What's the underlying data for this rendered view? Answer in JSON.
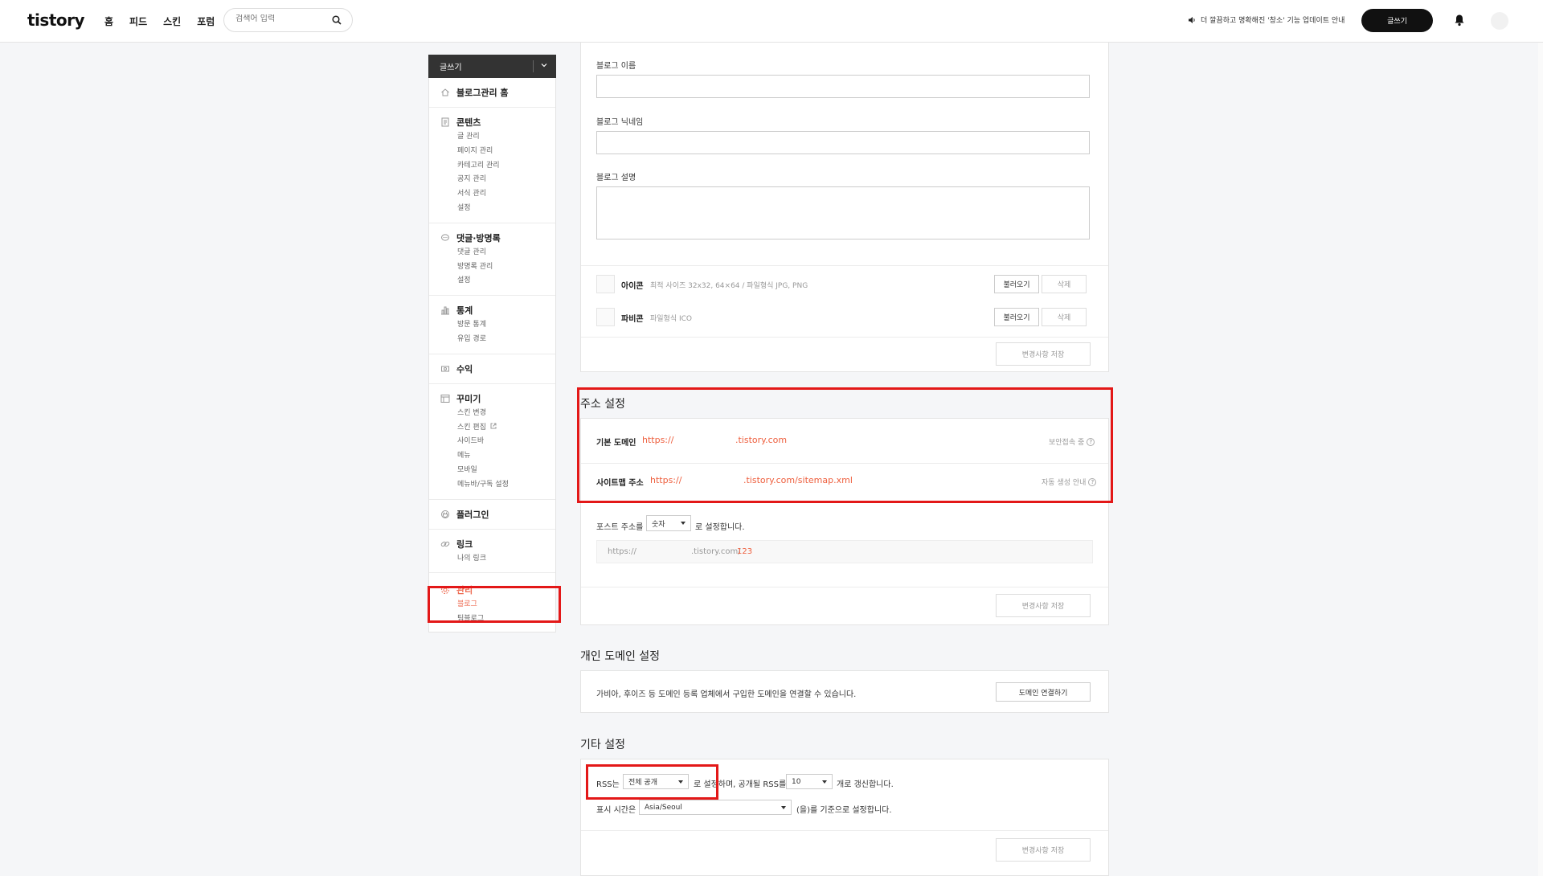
{
  "header": {
    "logo": "tistory",
    "nav": [
      "홈",
      "피드",
      "스킨",
      "포럼"
    ],
    "search_placeholder": "검색어 입력",
    "notice": "더 깔끔하고 명확해진 '창소' 기능 업데이트 안내",
    "write_label": "글쓰기"
  },
  "sidebar": {
    "write_label": "글쓰기",
    "groups": [
      {
        "title": "블로그관리 홈",
        "icon": "home-icon",
        "items": []
      },
      {
        "title": "콘텐츠",
        "icon": "document-icon",
        "items": [
          "글 관리",
          "페이지 관리",
          "카테고리 관리",
          "공지 관리",
          "서식 관리",
          "설정"
        ]
      },
      {
        "title": "댓글·방명록",
        "icon": "comment-icon",
        "items": [
          "댓글 관리",
          "방명록 관리",
          "설정"
        ]
      },
      {
        "title": "통계",
        "icon": "bar-chart-icon",
        "items": [
          "방문 통계",
          "유입 경로"
        ]
      },
      {
        "title": "수익",
        "icon": "revenue-icon",
        "items": []
      },
      {
        "title": "꾸미기",
        "icon": "layout-icon",
        "items": [
          "스킨 변경",
          "스킨 편집",
          "사이드바",
          "메뉴",
          "모바일",
          "메뉴바/구독 설정"
        ]
      },
      {
        "title": "플러그인",
        "icon": "plugin-icon",
        "items": []
      },
      {
        "title": "링크",
        "icon": "link-icon",
        "items": [
          "나의 링크"
        ]
      },
      {
        "title": "관리",
        "icon": "gear-icon",
        "items": [
          "블로그",
          "팀블로그"
        ]
      }
    ]
  },
  "blog_info": {
    "name_label": "블로그 이름",
    "nickname_label": "블로그 닉네임",
    "description_label": "블로그 설명",
    "icon_label": "아이콘",
    "icon_hint": "최적 사이즈 32x32, 64×64 / 파일형식 JPG, PNG",
    "favicon_label": "파비콘",
    "favicon_hint": "파일형식 ICO",
    "load_label": "불러오기",
    "delete_label": "삭제",
    "save_label": "변경사항 저장"
  },
  "address": {
    "title": "주소 설정",
    "domain_label": "기본 도메인",
    "domain_prefix": "https://",
    "domain_suffix": ".tistory.com",
    "secure_label": "보안접속 중",
    "sitemap_label": "사이트맵 주소",
    "sitemap_prefix": "https://",
    "sitemap_suffix": ".tistory.com/sitemap.xml",
    "sitemap_help": "자동 생성 안내",
    "post_label": "포스트 주소를",
    "post_select": "숫자",
    "post_suffix": "로 설정합니다.",
    "example_prefix": "https://",
    "example_domain": ".tistory.com/",
    "example_id": "123",
    "save_label": "변경사항 저장"
  },
  "custom_domain": {
    "title": "개인 도메인 설정",
    "description": "가비아, 후이즈 등 도메인 등록 업체에서 구입한 도메인을 연결할 수 있습니다.",
    "button": "도메인 연결하기"
  },
  "etc": {
    "title": "기타 설정",
    "rss_label": "RSS는",
    "rss_select": "전체 공개",
    "rss_mid": "로 설정하며, 공개될 RSS를",
    "rss_count": "10",
    "rss_suffix": "개로 갱신합니다.",
    "time_label": "표시 시간은",
    "time_select": "Asia/Seoul",
    "time_suffix": "(을)를 기준으로 설정합니다.",
    "save_label": "변경사항 저장"
  },
  "colors": {
    "accent": "#ee6d54",
    "highlight": "#e31818",
    "dark": "#111111"
  }
}
